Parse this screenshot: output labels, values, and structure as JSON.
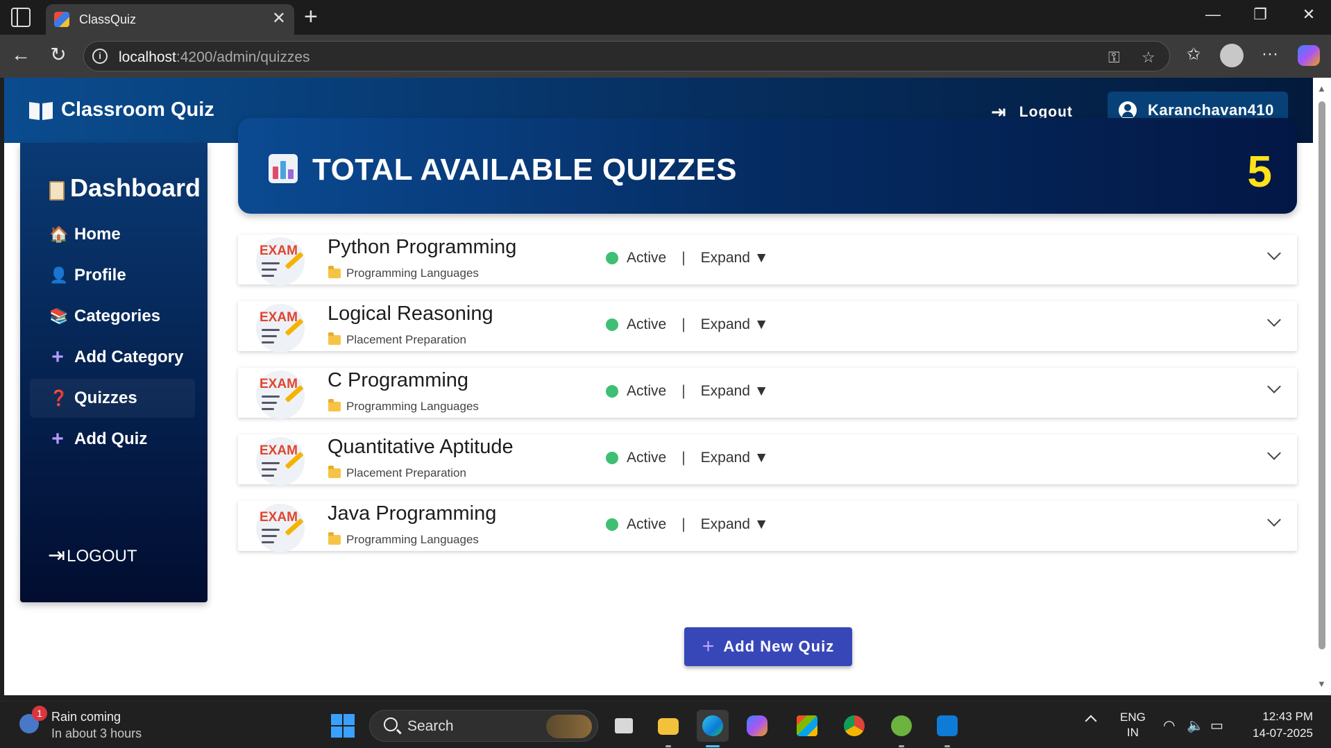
{
  "browser": {
    "tab_title": "ClassQuiz",
    "url_host": "localhost",
    "url_path": ":4200/admin/quizzes"
  },
  "header": {
    "brand": "Classroom Quiz",
    "logout_label": "Logout",
    "username": "Karanchavan410"
  },
  "sidebar": {
    "title": "Dashboard",
    "items": [
      {
        "label": "Home",
        "icon": "house-icon"
      },
      {
        "label": "Profile",
        "icon": "user-icon"
      },
      {
        "label": "Categories",
        "icon": "books-icon"
      },
      {
        "label": "Add Category",
        "icon": "plus-icon"
      },
      {
        "label": "Quizzes",
        "icon": "question-icon",
        "active": true
      },
      {
        "label": "Add Quiz",
        "icon": "plus-icon"
      }
    ],
    "logout_label": "LOGOUT"
  },
  "summary": {
    "label": "TOTAL AVAILABLE QUIZZES",
    "count": "5"
  },
  "quizzes": [
    {
      "title": "Python Programming",
      "category": "Programming Languages",
      "status": "Active",
      "expand": "Expand ▼"
    },
    {
      "title": "Logical Reasoning",
      "category": "Placement Preparation",
      "status": "Active",
      "expand": "Expand ▼"
    },
    {
      "title": "C Programming",
      "category": "Programming Languages",
      "status": "Active",
      "expand": "Expand ▼"
    },
    {
      "title": "Quantitative Aptitude",
      "category": "Placement Preparation",
      "status": "Active",
      "expand": "Expand ▼"
    },
    {
      "title": "Java Programming",
      "category": "Programming Languages",
      "status": "Active",
      "expand": "Expand ▼"
    }
  ],
  "exam_icon_text": "EXAM",
  "actions": {
    "add_quiz_label": "Add New Quiz"
  },
  "taskbar": {
    "weather_title": "Rain coming",
    "weather_sub": "In about 3 hours",
    "weather_badge": "1",
    "search_label": "Search",
    "lang_top": "ENG",
    "lang_bottom": "IN",
    "time": "12:43 PM",
    "date": "14-07-2025"
  },
  "colors": {
    "header_gradient_start": "#0a4c8f",
    "header_gradient_end": "#031a3c",
    "count_color": "#ffe21a",
    "status_active": "#3fbf73",
    "add_button": "#3847b8"
  }
}
